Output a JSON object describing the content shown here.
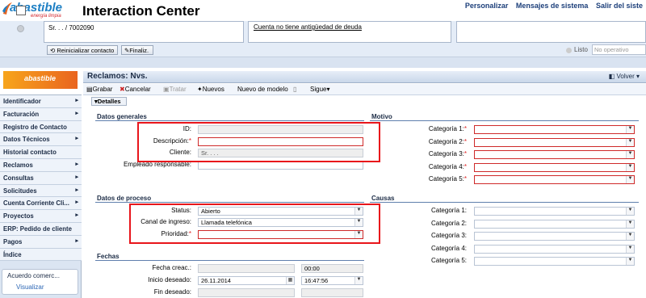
{
  "header": {
    "logo_text": "abastible",
    "logo_sub": "energía limpia",
    "app_title": "Interaction Center",
    "links": [
      "Personalizar",
      "Mensajes de sistema",
      "Salir del siste"
    ]
  },
  "context": {
    "customer": "Sr. . . / 7002090",
    "debt_note": "Cuenta no tiene antigüedad de deuda",
    "buttons": {
      "reinit": "Reinicializar contacto",
      "final": "Finaliz."
    },
    "status_label": "Listo",
    "status_value": "No operativo"
  },
  "sidebar": {
    "logo_text": "abastible",
    "items": [
      {
        "label": "Identificador",
        "arrow": true
      },
      {
        "label": "Facturación",
        "arrow": true
      },
      {
        "label": "Registro de Contacto",
        "arrow": false
      },
      {
        "label": "Datos Técnicos",
        "arrow": true
      },
      {
        "label": "Historial contacto",
        "arrow": false
      },
      {
        "label": "Reclamos",
        "arrow": true
      },
      {
        "label": "Consultas",
        "arrow": true
      },
      {
        "label": "Solicitudes",
        "arrow": true
      },
      {
        "label": "Cuenta Corriente Cli...",
        "arrow": true
      },
      {
        "label": "Proyectos",
        "arrow": true
      },
      {
        "label": "ERP: Pedido de cliente",
        "arrow": false
      },
      {
        "label": "Pagos",
        "arrow": true
      },
      {
        "label": "Índice",
        "arrow": false
      }
    ],
    "acuerdo": {
      "title": "Acuerdo comerc...",
      "link": "Visualizar"
    }
  },
  "main": {
    "title": "Reclamos: Nvs.",
    "volver": "Volver",
    "toolbar": {
      "grabar": "Grabar",
      "cancelar": "Cancelar",
      "tratar": "Tratar",
      "nuevos": "Nuevos",
      "nuevo_modelo": "Nuevo de modelo",
      "sigue": "Sigue"
    },
    "detalles": "Detalles",
    "datos_generales": {
      "title": "Datos generales",
      "id_label": "ID:",
      "desc_label": "Descripción:",
      "cliente_label": "Cliente:",
      "cliente_value": "Sr. . . .",
      "empleado_label": "Empleado responsable:"
    },
    "motivo": {
      "title": "Motivo",
      "labels": [
        "Categoría 1:",
        "Categoría 2:",
        "Categoría 3:",
        "Categoría 4:",
        "Categoría 5:"
      ]
    },
    "datos_proceso": {
      "title": "Datos de proceso",
      "status_label": "Status:",
      "status_value": "Abierto",
      "canal_label": "Canal de ingreso:",
      "canal_value": "Llamada telefónica",
      "prioridad_label": "Prioridad:"
    },
    "causas": {
      "title": "Causas",
      "labels": [
        "Categoría 1:",
        "Categoría 2:",
        "Categoría 3:",
        "Categoría 4:",
        "Categoría 5:"
      ]
    },
    "fechas": {
      "title": "Fechas",
      "creac_label": "Fecha creac.:",
      "creac_time": "00:00",
      "inicio_label": "Inicio deseado:",
      "inicio_date": "26.11.2014",
      "inicio_time": "16:47:56",
      "fin_label": "Fin deseado:"
    }
  },
  "colors": {
    "brand_blue": "#1d7fc4",
    "required_red": "#cf2a2a",
    "highlight_red": "#e8151b"
  }
}
